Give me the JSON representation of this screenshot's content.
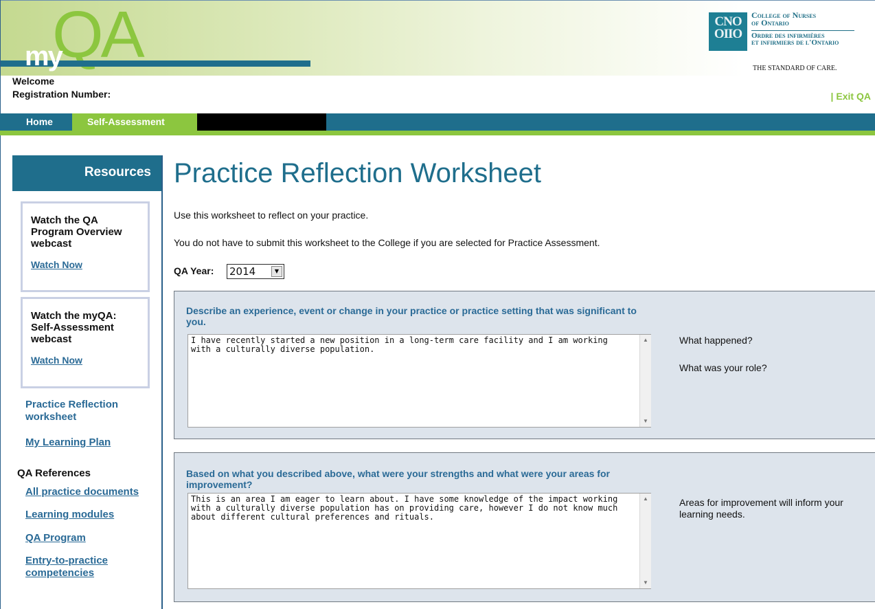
{
  "header": {
    "logo_my": "my",
    "logo_qa": "QA",
    "welcome_label": "Welcome",
    "registration_label": "Registration Number:",
    "exit_pipe": "|",
    "exit_label": "Exit QA",
    "college": {
      "monogram_top": "CNO",
      "monogram_bottom": "OIIO",
      "name_en_1": "College of Nurses",
      "name_en_2": "of Ontario",
      "name_fr_1": "Ordre des infirmières",
      "name_fr_2": "et infirmiers de l'Ontario",
      "tagline": "THE STANDARD OF CARE."
    }
  },
  "nav": {
    "home": "Home",
    "self_assessment": "Self-Assessment"
  },
  "sidebar": {
    "heading": "Resources",
    "boxes": [
      {
        "title": "Watch the QA Program Overview webcast",
        "link": "Watch Now"
      },
      {
        "title": "Watch the myQA: Self-Assessment webcast",
        "link": "Watch Now"
      }
    ],
    "practice_reflection": "Practice Reflection worksheet",
    "learning_plan": "My Learning Plan",
    "references_heading": "QA References",
    "references": [
      "All practice documents",
      "Learning modules",
      "QA Program",
      "Entry-to-practice competencies"
    ]
  },
  "main": {
    "title": "Practice Reflection Worksheet",
    "intro_1": "Use this worksheet to reflect on your practice.",
    "intro_2": "You do not have to submit this worksheet to the College if you are selected for Practice Assessment.",
    "year_label": "QA Year:",
    "year_value": "2014",
    "questions": [
      {
        "question": "Describe an experience, event or change in your practice or practice setting that was significant to you.",
        "answer": "I have recently started a new position in a long-term care facility and I am working with a culturally diverse population.",
        "hint_1": "What happened?",
        "hint_2": "What was your role?"
      },
      {
        "question": "Based on what you described above, what were your strengths and what were your areas for improvement?",
        "answer": "This is an area I am eager to learn about. I have some knowledge of the impact working with a culturally diverse population has on providing care, however I do not know much about different cultural preferences and rituals.",
        "hint_1": "Areas for improvement will inform your learning needs."
      }
    ]
  },
  "colors": {
    "brand_teal": "#1f6e8c",
    "brand_green": "#8cc63f",
    "link_blue": "#2a6a96",
    "panel_bg": "#dde4ec"
  }
}
